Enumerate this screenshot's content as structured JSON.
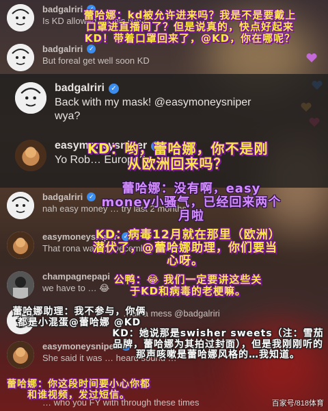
{
  "comments": [
    {
      "user": "badgalriri",
      "verified": true,
      "text": "Is KD allowed on this live?"
    },
    {
      "user": "badgalriri",
      "verified": true,
      "text": "But foreal get well soon KD"
    },
    {
      "user": "badgalriri",
      "verified": true,
      "text": "Back with my mask! @easymoneysniper wya?"
    },
    {
      "user": "easymoneysniper",
      "verified": true,
      "text": "Yo Rob… Europe?"
    },
    {
      "user": "badgalriri",
      "verified": true,
      "text": "nah easy money … try last 2 months"
    },
    {
      "user": "easymoneysniper",
      "verified": true,
      "text": "That rona was … December @mdollas11"
    },
    {
      "user": "champagnepapi",
      "verified": false,
      "text": "we have to … 😂"
    },
    {
      "user": "badgalriri",
      "verified": true,
      "text": "…all a mess @badgalriri"
    },
    {
      "user": "easymoneysniper",
      "verified": true,
      "text": "She said it was … heard sound …"
    },
    {
      "user": "",
      "verified": false,
      "text": "… who you FY with through these times"
    }
  ],
  "captions": {
    "c1": "蕾哈娜：kd被允许进来吗？我是不是要戴上口罩进直播间了？但是说真的，快点好起来KD！带着口罩回来了，@KD，你在哪呢？",
    "c2": "KD：哟，蕾哈娜，你不是刚从欧洲回来吗？",
    "c3": "蕾哈娜：没有啊，easy money小骚气，已经回来两个月啦",
    "c4": "KD：病毒12月就在那里（欧洲）潜伏了，@蕾哈娜助理，你们要当心呀。",
    "c5": "公鸭：😂 我们一定要讲这些关于KD和病毒的老梗嘛。",
    "c6": "蕾哈娜助理：我不参与，你俩都是小混蛋@蕾哈娜 @KD",
    "c7": "KD：她说那是swisher sweets（注：雪茄品牌，蕾哈娜为其拍过封面），但是我刚刚听的那声咳嗽是蕾哈娜风格的…我知道。",
    "c8": "蕾哈娜：你这段时间要小心你都和谁视频，发过短信。"
  },
  "watermark": "百家号/818体育"
}
